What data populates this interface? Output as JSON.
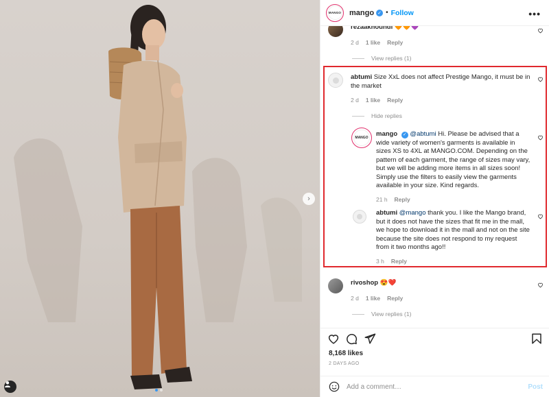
{
  "header": {
    "logo_text": "MANGO",
    "username": "mango",
    "follow_label": "Follow",
    "more_label": "•••"
  },
  "comments": [
    {
      "username": "rezaakhoundi",
      "text": "🧡🧡💜",
      "time": "2 d",
      "likes": "1 like",
      "reply_label": "Reply",
      "view_replies": "View replies (1)"
    },
    {
      "username": "abtumi",
      "text": "Size XxL does not affect Prestige Mango, it must be in the market",
      "time": "2 d",
      "likes": "1 like",
      "reply_label": "Reply",
      "hide_replies": "Hide replies",
      "replies": [
        {
          "username": "mango",
          "mention": "@abtumi",
          "text": "Hi. Please be advised that a wide variety of women's garments is available in sizes XS to 4XL at MANGO.COM. Depending on the pattern of each garment, the range of sizes may vary, but we will be adding more items in all sizes soon! Simply use the filters to easily view the garments available in your size. Kind regards.",
          "time": "21 h",
          "reply_label": "Reply"
        },
        {
          "username": "abtumi",
          "mention": "@mango",
          "text": "thank you. I like the Mango brand, but it does not have the sizes that fit me in the mall, we hope to download it in the mall and not on the site because the site does not respond to my request from it two months ago!!",
          "time": "3 h",
          "reply_label": "Reply"
        }
      ]
    },
    {
      "username": "rivoshop",
      "text": "😍❤️",
      "time": "2 d",
      "likes": "1 like",
      "reply_label": "Reply",
      "view_replies": "View replies (1)"
    }
  ],
  "actions": {
    "likes": "8,168 likes",
    "date": "2 DAYS AGO"
  },
  "add_comment": {
    "placeholder": "Add a comment…",
    "post_label": "Post"
  },
  "colors": {
    "accent": "#0095f6",
    "highlight": "#e0282d",
    "jacket": "#d2b79c",
    "trousers": "#a86a42"
  },
  "icons": [
    "next-arrow-icon",
    "user-tag-icon",
    "verified-icon",
    "more-icon",
    "heart-icon",
    "comment-icon",
    "share-icon",
    "bookmark-icon",
    "emoji-icon"
  ]
}
